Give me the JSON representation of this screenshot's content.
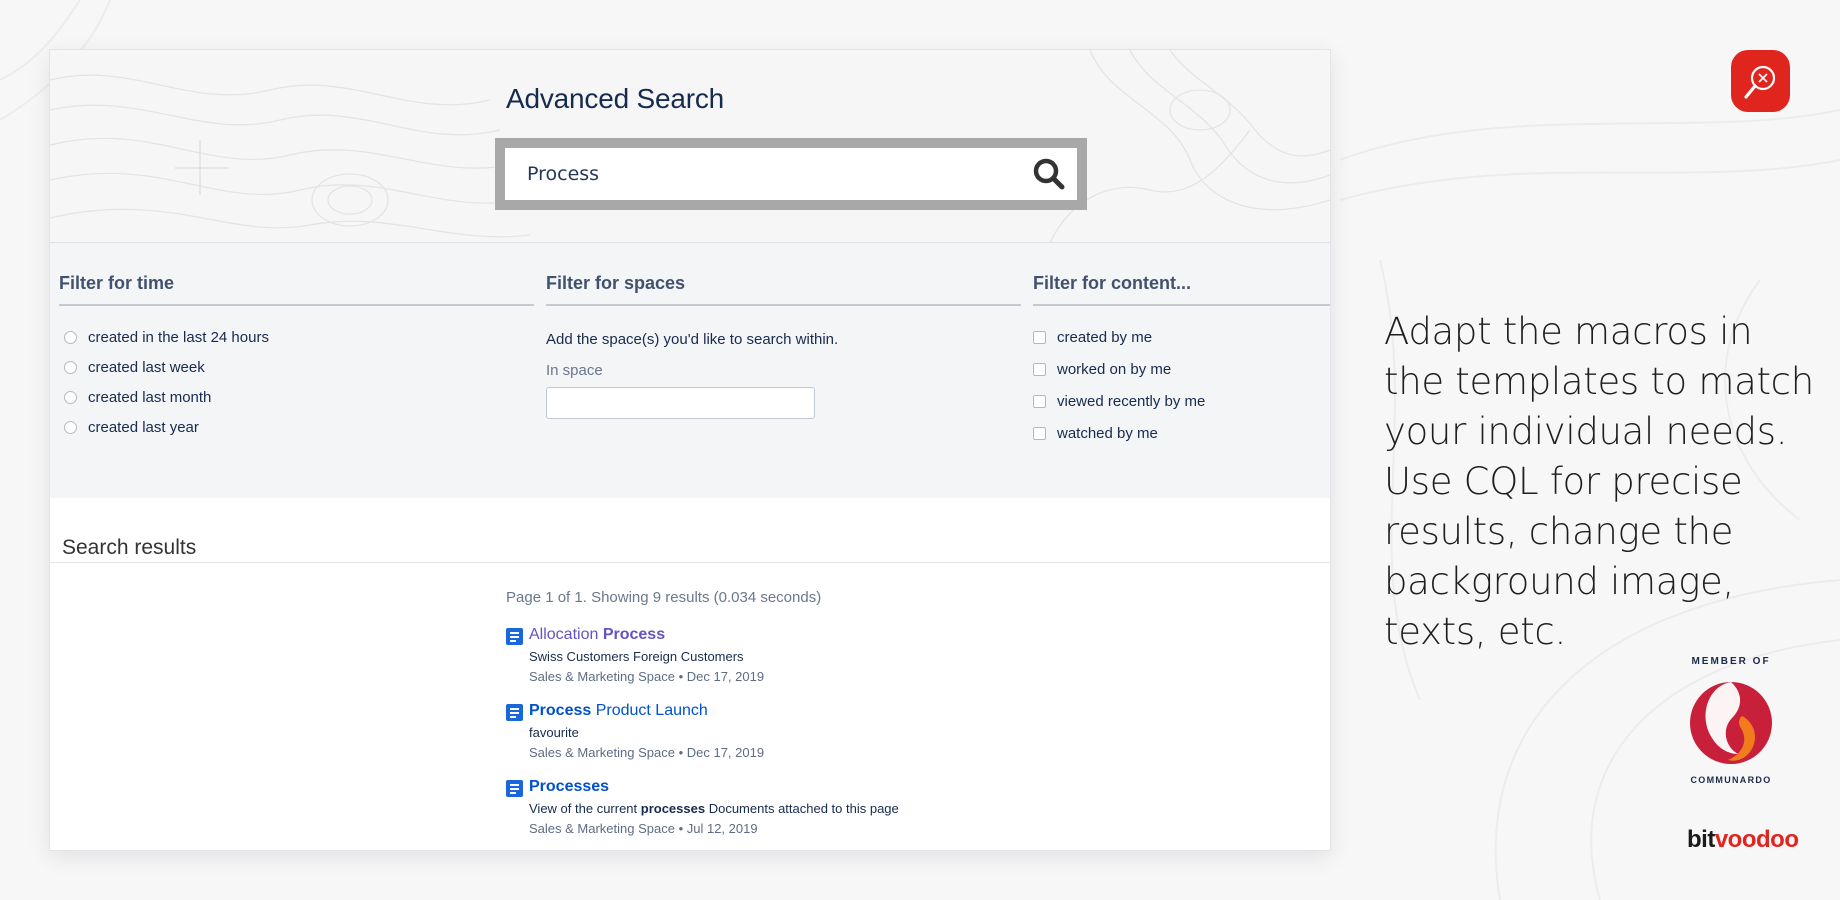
{
  "hero": {
    "title": "Advanced Search",
    "search_value": "Process"
  },
  "filters": {
    "time": {
      "heading": "Filter for time",
      "options": [
        "created in the last 24 hours",
        "created last week",
        "created last month",
        "created last year"
      ]
    },
    "spaces": {
      "heading": "Filter for spaces",
      "description": "Add the space(s) you'd like to search within.",
      "label": "In space",
      "value": ""
    },
    "content": {
      "heading": "Filter for content...",
      "options": [
        "created by me",
        "worked on by me",
        "viewed recently by me",
        "watched by me"
      ]
    }
  },
  "results": {
    "heading": "Search results",
    "summary": "Page 1 of 1. Showing 9 results (0.034 seconds)",
    "items": [
      {
        "title_plain": "Allocation ",
        "title_bold": "Process",
        "excerpt": "Swiss Customers Foreign Customers",
        "meta": "Sales & Marketing Space • Dec 17, 2019"
      },
      {
        "title_bold": "Process",
        "title_plain": " Product Launch",
        "excerpt": "favourite",
        "meta": "Sales & Marketing Space • Dec 17, 2019"
      },
      {
        "title_bold": "Processes",
        "excerpt_before": "View of the current ",
        "excerpt_bold": "processes",
        "excerpt_after": " Documents attached to this page",
        "meta": "Sales & Marketing Space • Jul 12, 2019"
      }
    ]
  },
  "side": {
    "text": "Adapt the macros in the templates to match your individual needs. Use CQL for precise results, change the background image, texts, etc.",
    "member_of": "MEMBER OF",
    "communardo": "COMMUNARDO",
    "bitvoodoo_a": "bit",
    "bitvoodoo_b": "voodoo"
  },
  "colors": {
    "brand_red": "#e0251e",
    "link_blue": "#0052cc",
    "visited_purple": "#6554c0",
    "doc_icon_blue": "#1868db"
  },
  "icons": [
    "search-icon",
    "page-icon",
    "app-logo-icon",
    "communardo-logo"
  ]
}
